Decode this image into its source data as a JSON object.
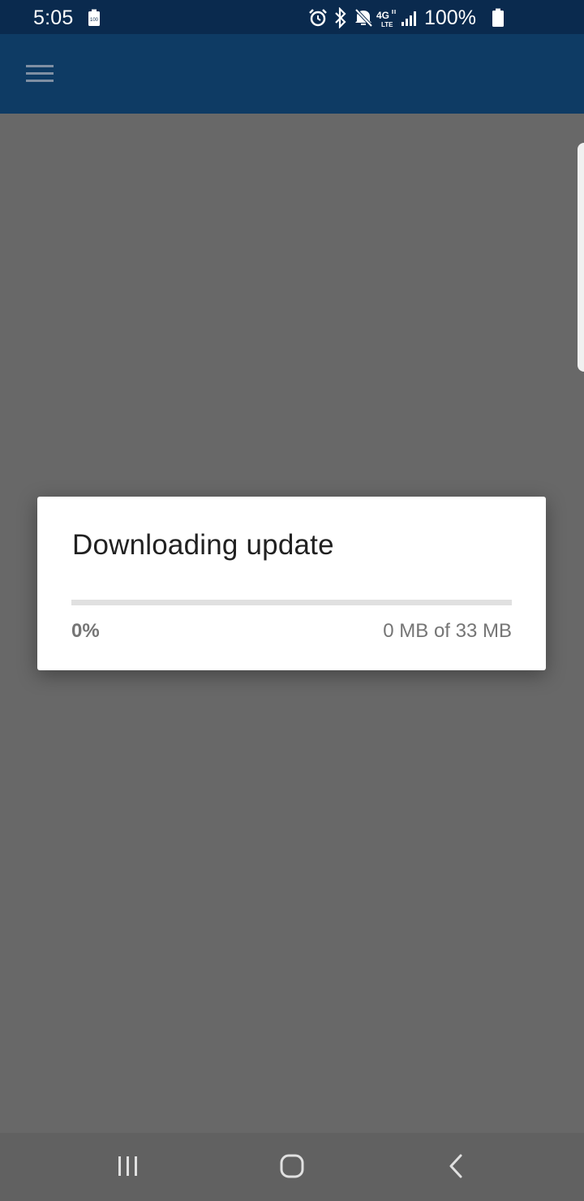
{
  "status_bar": {
    "time": "5:05",
    "battery_percent": "100%",
    "icons": [
      "battery-saver-icon",
      "alarm-icon",
      "bluetooth-icon",
      "mute-icon",
      "4g-lte-icon",
      "signal-icon",
      "battery-icon"
    ]
  },
  "app_bar": {
    "menu_icon": "hamburger-menu-icon",
    "color": "#0e3b64"
  },
  "dialog": {
    "title": "Downloading update",
    "progress_fraction": 0,
    "progress_percent_label": "0%",
    "progress_size_label": "0 MB of 33 MB"
  },
  "nav_bar": {
    "icons": [
      "recent-apps-icon",
      "home-icon",
      "back-icon"
    ]
  },
  "colors": {
    "status_bar_bg": "#0a2a4e",
    "app_bar_bg": "#0e3b64",
    "scrim_bg": "#686868"
  }
}
